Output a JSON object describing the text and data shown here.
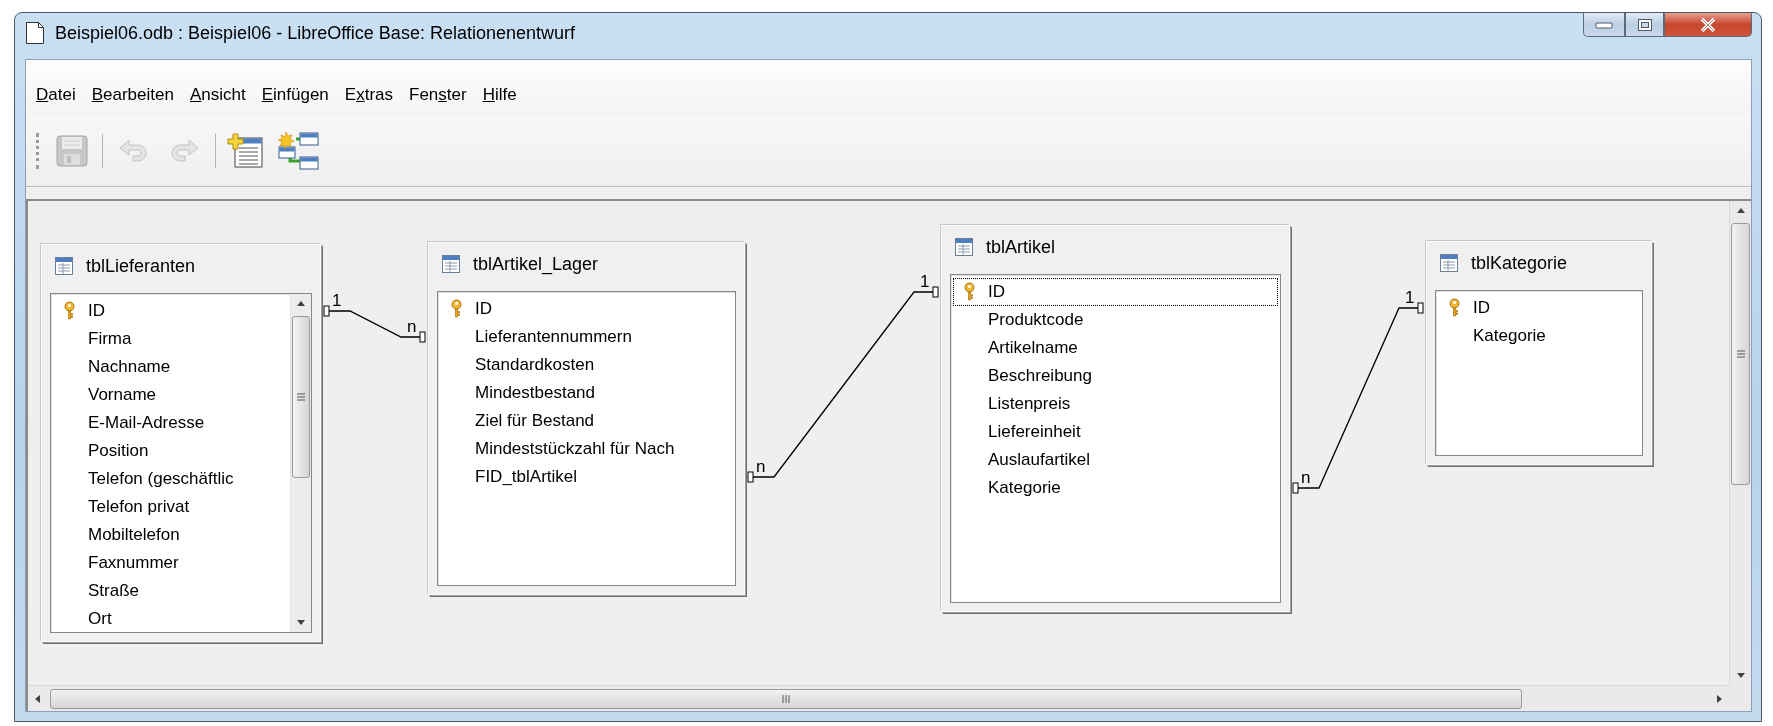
{
  "window": {
    "title": "Beispiel06.odb : Beispiel06 - LibreOffice Base: Relationenentwurf"
  },
  "menu": [
    {
      "accel": "D",
      "post": "atei"
    },
    {
      "accel": "B",
      "post": "earbeiten"
    },
    {
      "accel": "A",
      "post": "nsicht"
    },
    {
      "accel": "E",
      "post": "infügen"
    },
    {
      "pre": "E",
      "accel": "x",
      "post": "tras"
    },
    {
      "pre": "Fen",
      "accel": "s",
      "post": "ter"
    },
    {
      "accel": "H",
      "post": "ilfe"
    }
  ],
  "toolbar": [
    {
      "kind": "save",
      "disabled": true
    },
    {
      "kind": "separator"
    },
    {
      "kind": "undo",
      "disabled": true
    },
    {
      "kind": "redo",
      "disabled": true
    },
    {
      "kind": "separator"
    },
    {
      "kind": "new-table",
      "disabled": false
    },
    {
      "kind": "new-relation",
      "disabled": false
    }
  ],
  "tables": [
    {
      "title": "tblLieferanten",
      "scrollable": true,
      "fields": [
        {
          "name": "ID",
          "primary_key": true,
          "selected": false
        },
        {
          "name": "Firma",
          "primary_key": false,
          "selected": false
        },
        {
          "name": "Nachname",
          "primary_key": false,
          "selected": false
        },
        {
          "name": "Vorname",
          "primary_key": false,
          "selected": false
        },
        {
          "name": "E-Mail-Adresse",
          "primary_key": false,
          "selected": false
        },
        {
          "name": "Position",
          "primary_key": false,
          "selected": false
        },
        {
          "name": "Telefon (geschäftlic",
          "primary_key": false,
          "selected": false
        },
        {
          "name": "Telefon privat",
          "primary_key": false,
          "selected": false
        },
        {
          "name": "Mobiltelefon",
          "primary_key": false,
          "selected": false
        },
        {
          "name": "Faxnummer",
          "primary_key": false,
          "selected": false
        },
        {
          "name": "Straße",
          "primary_key": false,
          "selected": false
        },
        {
          "name": "Ort",
          "primary_key": false,
          "selected": false
        }
      ]
    },
    {
      "title": "tblArtikel_Lager",
      "scrollable": false,
      "fields": [
        {
          "name": "ID",
          "primary_key": true,
          "selected": false
        },
        {
          "name": "Lieferantennummern",
          "primary_key": false,
          "selected": false
        },
        {
          "name": "Standardkosten",
          "primary_key": false,
          "selected": false
        },
        {
          "name": "Mindestbestand",
          "primary_key": false,
          "selected": false
        },
        {
          "name": "Ziel für Bestand",
          "primary_key": false,
          "selected": false
        },
        {
          "name": "Mindeststückzahl für Nach",
          "primary_key": false,
          "selected": false
        },
        {
          "name": "FID_tblArtikel",
          "primary_key": false,
          "selected": false
        }
      ]
    },
    {
      "title": "tblArtikel",
      "scrollable": false,
      "fields": [
        {
          "name": "ID",
          "primary_key": true,
          "selected": true
        },
        {
          "name": "Produktcode",
          "primary_key": false,
          "selected": false
        },
        {
          "name": "Artikelname",
          "primary_key": false,
          "selected": false
        },
        {
          "name": "Beschreibung",
          "primary_key": false,
          "selected": false
        },
        {
          "name": "Listenpreis",
          "primary_key": false,
          "selected": false
        },
        {
          "name": "Liefereinheit",
          "primary_key": false,
          "selected": false
        },
        {
          "name": "Auslaufartikel",
          "primary_key": false,
          "selected": false
        },
        {
          "name": "Kategorie",
          "primary_key": false,
          "selected": false
        }
      ]
    },
    {
      "title": "tblKategorie",
      "scrollable": false,
      "fields": [
        {
          "name": "ID",
          "primary_key": true,
          "selected": false
        },
        {
          "name": "Kategorie",
          "primary_key": false,
          "selected": false
        }
      ]
    }
  ],
  "relations": [
    {
      "start_label": "1",
      "end_label": "n"
    },
    {
      "start_label": "n",
      "end_label": "1"
    },
    {
      "start_label": "n",
      "end_label": "1"
    }
  ]
}
